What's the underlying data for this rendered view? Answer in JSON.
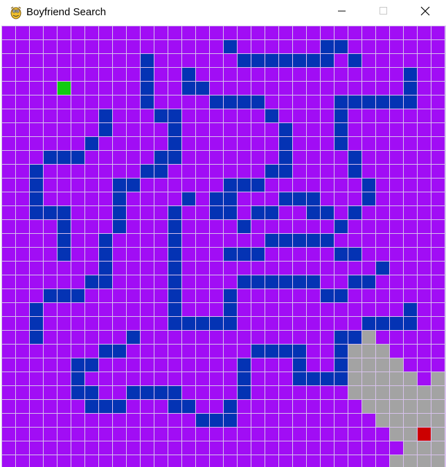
{
  "window": {
    "title": "Boyfriend Search",
    "icon": "pygame-snake-icon",
    "controls": [
      "minimize-icon",
      "maximize-icon",
      "close-icon"
    ]
  },
  "grid": {
    "columns": 32,
    "rows": 32,
    "colors": {
      "empty": "#a10df5",
      "wall": "#0433b4",
      "explored": "#a3a3a3",
      "start": "#11cc11",
      "end": "#cc0000",
      "grid_line": "#d7c2ec"
    },
    "start": [
      4,
      4
    ],
    "end": [
      30,
      29
    ],
    "walls": [
      [
        16,
        1
      ],
      [
        23,
        1
      ],
      [
        24,
        1
      ],
      [
        10,
        2
      ],
      [
        17,
        2
      ],
      [
        18,
        2
      ],
      [
        19,
        2
      ],
      [
        20,
        2
      ],
      [
        21,
        2
      ],
      [
        22,
        2
      ],
      [
        23,
        2
      ],
      [
        25,
        2
      ],
      [
        10,
        3
      ],
      [
        13,
        3
      ],
      [
        29,
        3
      ],
      [
        10,
        4
      ],
      [
        13,
        4
      ],
      [
        14,
        4
      ],
      [
        29,
        4
      ],
      [
        10,
        5
      ],
      [
        15,
        5
      ],
      [
        16,
        5
      ],
      [
        17,
        5
      ],
      [
        18,
        5
      ],
      [
        24,
        5
      ],
      [
        25,
        5
      ],
      [
        26,
        5
      ],
      [
        27,
        5
      ],
      [
        28,
        5
      ],
      [
        29,
        5
      ],
      [
        7,
        6
      ],
      [
        11,
        6
      ],
      [
        12,
        6
      ],
      [
        19,
        6
      ],
      [
        24,
        6
      ],
      [
        7,
        7
      ],
      [
        12,
        7
      ],
      [
        20,
        7
      ],
      [
        24,
        7
      ],
      [
        6,
        8
      ],
      [
        12,
        8
      ],
      [
        20,
        8
      ],
      [
        24,
        8
      ],
      [
        3,
        9
      ],
      [
        4,
        9
      ],
      [
        5,
        9
      ],
      [
        11,
        9
      ],
      [
        12,
        9
      ],
      [
        20,
        9
      ],
      [
        25,
        9
      ],
      [
        2,
        10
      ],
      [
        10,
        10
      ],
      [
        11,
        10
      ],
      [
        19,
        10
      ],
      [
        20,
        10
      ],
      [
        25,
        10
      ],
      [
        2,
        11
      ],
      [
        8,
        11
      ],
      [
        9,
        11
      ],
      [
        16,
        11
      ],
      [
        17,
        11
      ],
      [
        18,
        11
      ],
      [
        26,
        11
      ],
      [
        2,
        12
      ],
      [
        8,
        12
      ],
      [
        13,
        12
      ],
      [
        15,
        12
      ],
      [
        16,
        12
      ],
      [
        20,
        12
      ],
      [
        21,
        12
      ],
      [
        22,
        12
      ],
      [
        26,
        12
      ],
      [
        2,
        13
      ],
      [
        3,
        13
      ],
      [
        4,
        13
      ],
      [
        8,
        13
      ],
      [
        12,
        13
      ],
      [
        15,
        13
      ],
      [
        16,
        13
      ],
      [
        18,
        13
      ],
      [
        19,
        13
      ],
      [
        22,
        13
      ],
      [
        23,
        13
      ],
      [
        25,
        13
      ],
      [
        4,
        14
      ],
      [
        8,
        14
      ],
      [
        12,
        14
      ],
      [
        17,
        14
      ],
      [
        24,
        14
      ],
      [
        4,
        15
      ],
      [
        7,
        15
      ],
      [
        12,
        15
      ],
      [
        19,
        15
      ],
      [
        20,
        15
      ],
      [
        21,
        15
      ],
      [
        22,
        15
      ],
      [
        23,
        15
      ],
      [
        4,
        16
      ],
      [
        7,
        16
      ],
      [
        12,
        16
      ],
      [
        16,
        16
      ],
      [
        17,
        16
      ],
      [
        18,
        16
      ],
      [
        24,
        16
      ],
      [
        25,
        16
      ],
      [
        7,
        17
      ],
      [
        12,
        17
      ],
      [
        27,
        17
      ],
      [
        6,
        18
      ],
      [
        7,
        18
      ],
      [
        12,
        18
      ],
      [
        17,
        18
      ],
      [
        18,
        18
      ],
      [
        19,
        18
      ],
      [
        20,
        18
      ],
      [
        21,
        18
      ],
      [
        22,
        18
      ],
      [
        25,
        18
      ],
      [
        26,
        18
      ],
      [
        3,
        19
      ],
      [
        4,
        19
      ],
      [
        5,
        19
      ],
      [
        12,
        19
      ],
      [
        16,
        19
      ],
      [
        23,
        19
      ],
      [
        24,
        19
      ],
      [
        2,
        20
      ],
      [
        12,
        20
      ],
      [
        16,
        20
      ],
      [
        29,
        20
      ],
      [
        2,
        21
      ],
      [
        12,
        21
      ],
      [
        13,
        21
      ],
      [
        14,
        21
      ],
      [
        15,
        21
      ],
      [
        16,
        21
      ],
      [
        26,
        21
      ],
      [
        27,
        21
      ],
      [
        28,
        21
      ],
      [
        29,
        21
      ],
      [
        2,
        22
      ],
      [
        9,
        22
      ],
      [
        24,
        22
      ],
      [
        25,
        22
      ],
      [
        7,
        23
      ],
      [
        8,
        23
      ],
      [
        18,
        23
      ],
      [
        19,
        23
      ],
      [
        20,
        23
      ],
      [
        21,
        23
      ],
      [
        24,
        23
      ],
      [
        5,
        24
      ],
      [
        6,
        24
      ],
      [
        17,
        24
      ],
      [
        21,
        24
      ],
      [
        24,
        24
      ],
      [
        5,
        25
      ],
      [
        17,
        25
      ],
      [
        21,
        25
      ],
      [
        22,
        25
      ],
      [
        23,
        25
      ],
      [
        24,
        25
      ],
      [
        5,
        26
      ],
      [
        6,
        26
      ],
      [
        9,
        26
      ],
      [
        10,
        26
      ],
      [
        11,
        26
      ],
      [
        12,
        26
      ],
      [
        17,
        26
      ],
      [
        6,
        27
      ],
      [
        7,
        27
      ],
      [
        8,
        27
      ],
      [
        12,
        27
      ],
      [
        13,
        27
      ],
      [
        16,
        27
      ],
      [
        14,
        28
      ],
      [
        15,
        28
      ],
      [
        16,
        28
      ]
    ],
    "explored": [
      [
        26,
        22
      ],
      [
        25,
        23
      ],
      [
        26,
        23
      ],
      [
        27,
        23
      ],
      [
        25,
        24
      ],
      [
        26,
        24
      ],
      [
        27,
        24
      ],
      [
        28,
        24
      ],
      [
        25,
        25
      ],
      [
        26,
        25
      ],
      [
        27,
        25
      ],
      [
        28,
        25
      ],
      [
        29,
        25
      ],
      [
        31,
        25
      ],
      [
        25,
        26
      ],
      [
        26,
        26
      ],
      [
        27,
        26
      ],
      [
        28,
        26
      ],
      [
        29,
        26
      ],
      [
        30,
        26
      ],
      [
        31,
        26
      ],
      [
        26,
        27
      ],
      [
        27,
        27
      ],
      [
        28,
        27
      ],
      [
        29,
        27
      ],
      [
        30,
        27
      ],
      [
        31,
        27
      ],
      [
        27,
        28
      ],
      [
        28,
        28
      ],
      [
        29,
        28
      ],
      [
        30,
        28
      ],
      [
        31,
        28
      ],
      [
        28,
        29
      ],
      [
        29,
        29
      ],
      [
        31,
        29
      ],
      [
        29,
        30
      ],
      [
        30,
        30
      ],
      [
        31,
        30
      ],
      [
        28,
        31
      ],
      [
        29,
        31
      ],
      [
        30,
        31
      ],
      [
        31,
        31
      ]
    ]
  }
}
